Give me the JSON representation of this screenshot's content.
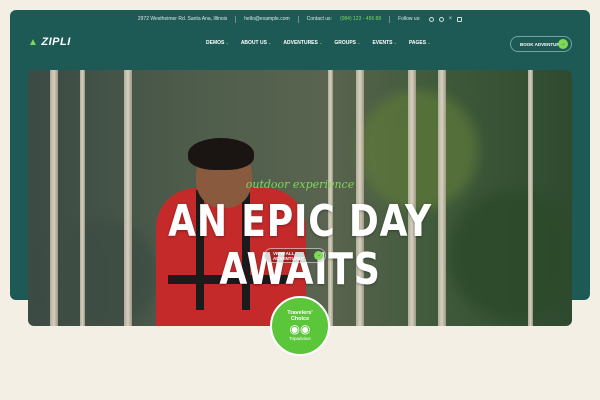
{
  "topbar": {
    "address": "2972 Westheimer Rd. Santa Ana, Illinois",
    "email": "hello@example.com",
    "contact_label": "Contact us:",
    "contact_phone": "(084) 123 - 456 88",
    "follow_label": "Follow us:"
  },
  "logo": {
    "text": "ZIPLI"
  },
  "nav": [
    "DEMOS",
    "ABOUT US",
    "ADVENTURES",
    "GROUPS",
    "EVENTS",
    "PAGES"
  ],
  "header": {
    "book_label": "BOOK ADVENTURE"
  },
  "hero": {
    "subtitle": "outdoor experience",
    "title_line1": "AN EPIC DAY",
    "title_line2": "AWAITS",
    "button_label": "VIEW ALL ADVENTURES"
  },
  "badge": {
    "line1": "Travelers'",
    "line2": "Choice",
    "brand": "Tripadvisor"
  },
  "colors": {
    "panel": "#1d5a56",
    "accent": "#7ed957",
    "background": "#f3efe4"
  },
  "icons": [
    "tree-icon",
    "facebook-icon",
    "instagram-icon",
    "x-icon",
    "email-icon",
    "arrow-right-icon",
    "owl-icon"
  ]
}
